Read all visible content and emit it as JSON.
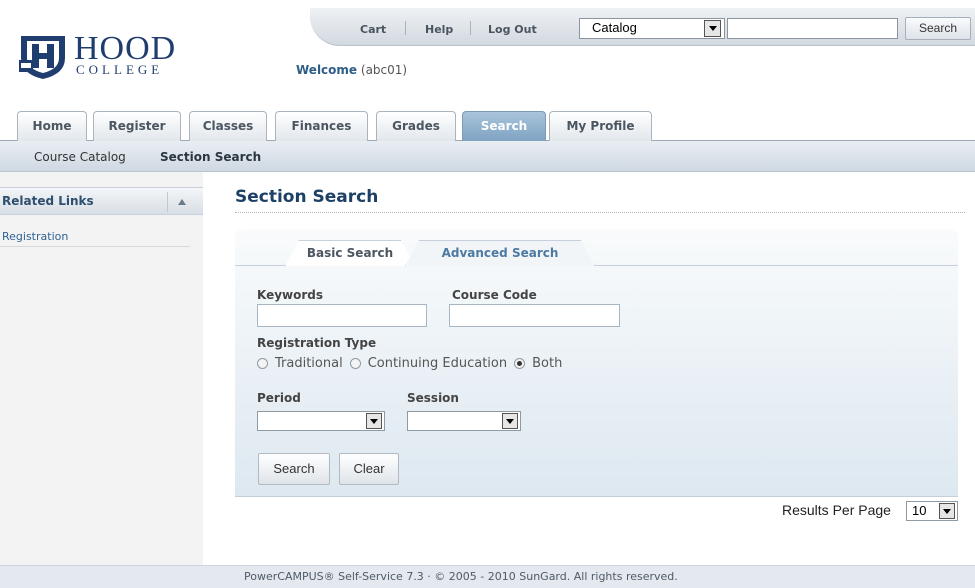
{
  "header": {
    "cart_label": "Cart",
    "help_label": "Help",
    "logout_label": "Log Out",
    "catalog_selected": "Catalog",
    "search_input_value": "",
    "search_button_label": "Search",
    "welcome_prefix": "Welcome",
    "welcome_user": "(abc01)"
  },
  "logo": {
    "name_big": "HOOD",
    "name_small": "COLLEGE",
    "icon": "shield-crest-icon"
  },
  "tabs": [
    {
      "label": "Home"
    },
    {
      "label": "Register"
    },
    {
      "label": "Classes"
    },
    {
      "label": "Finances"
    },
    {
      "label": "Grades"
    },
    {
      "label": "Search",
      "active": true
    },
    {
      "label": "My Profile"
    }
  ],
  "subnav": {
    "items": [
      {
        "label": "Course Catalog"
      },
      {
        "label": "Section Search",
        "active": true
      }
    ]
  },
  "sidebar": {
    "title": "Related Links",
    "links": [
      {
        "label": "Registration"
      }
    ]
  },
  "main": {
    "page_title": "Section Search",
    "subtabs": [
      {
        "label": "Basic Search",
        "active": true
      },
      {
        "label": "Advanced Search"
      }
    ],
    "keywords_label": "Keywords",
    "keywords_value": "",
    "course_code_label": "Course Code",
    "course_code_value": "",
    "registration_type_label": "Registration Type",
    "registration_options": [
      {
        "label": "Traditional",
        "checked": false
      },
      {
        "label": "Continuing Education",
        "checked": false
      },
      {
        "label": "Both",
        "checked": true
      }
    ],
    "period_label": "Period",
    "period_value": "",
    "session_label": "Session",
    "session_value": "",
    "search_button_label": "Search",
    "clear_button_label": "Clear",
    "results_per_page_label": "Results Per Page",
    "results_per_page_value": "10"
  },
  "footer": {
    "text": "PowerCAMPUS® Self-Service 7.3 · © 2005 - 2010 SunGard. All rights reserved."
  },
  "colors": {
    "brand_navy": "#1f3d6e",
    "active_tab": "#7fa3c2",
    "link_blue": "#2f6393",
    "title_blue": "#1d4166"
  }
}
